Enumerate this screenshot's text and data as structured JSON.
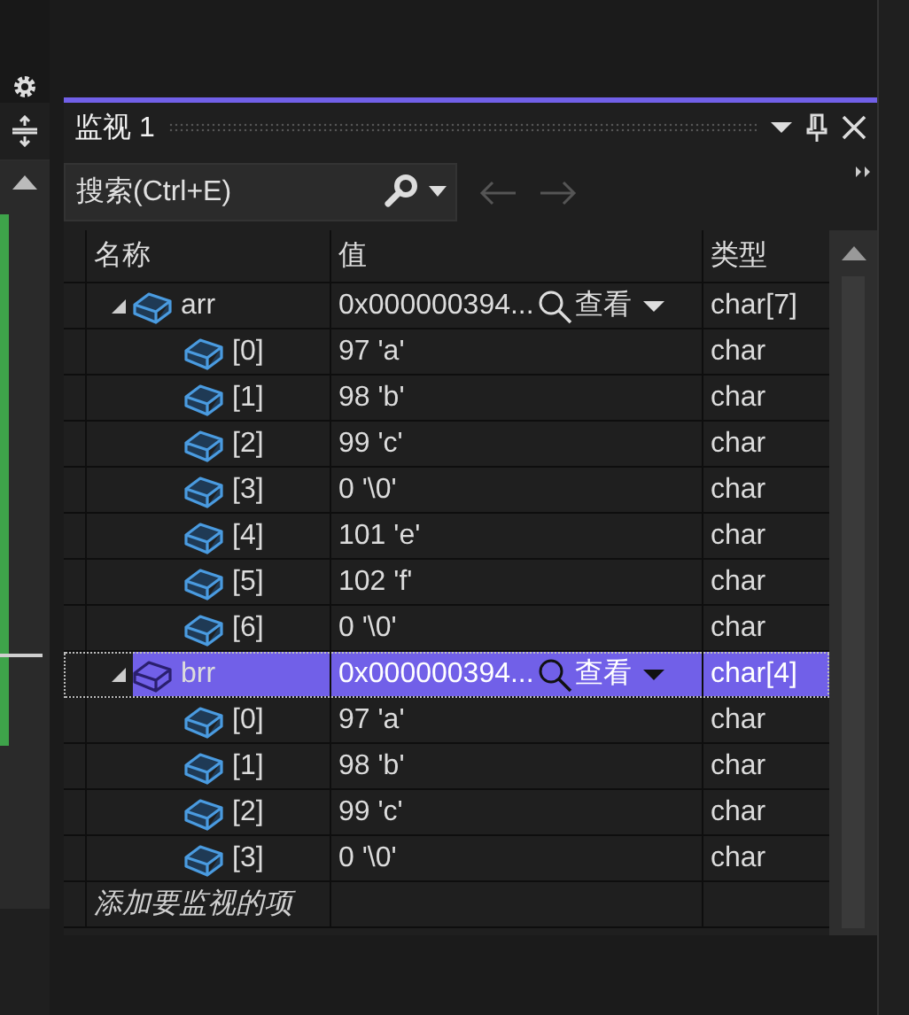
{
  "window": {
    "title": "监视 1"
  },
  "search": {
    "placeholder": "搜索(Ctrl+E)"
  },
  "columns": [
    "名称",
    "值",
    "类型"
  ],
  "rows": [
    {
      "name": "arr",
      "value": "0x000000394...",
      "view": "查看",
      "type": "char[7]",
      "expanded": true,
      "selected": false,
      "children": [
        {
          "name": "[0]",
          "value": "97 'a'",
          "type": "char",
          "selected": false
        },
        {
          "name": "[1]",
          "value": "98 'b'",
          "type": "char",
          "selected": false
        },
        {
          "name": "[2]",
          "value": "99 'c'",
          "type": "char",
          "selected": false
        },
        {
          "name": "[3]",
          "value": "0 '\\0'",
          "type": "char",
          "selected": false
        },
        {
          "name": "[4]",
          "value": "101 'e'",
          "type": "char",
          "selected": false
        },
        {
          "name": "[5]",
          "value": "102 'f'",
          "type": "char",
          "selected": false
        },
        {
          "name": "[6]",
          "value": "0 '\\0'",
          "type": "char",
          "selected": false
        }
      ]
    },
    {
      "name": "brr",
      "value": "0x000000394...",
      "view": "查看",
      "type": "char[4]",
      "expanded": true,
      "selected": true,
      "children": [
        {
          "name": "[0]",
          "value": "97 'a'",
          "type": "char",
          "selected": false
        },
        {
          "name": "[1]",
          "value": "98 'b'",
          "type": "char",
          "selected": false
        },
        {
          "name": "[2]",
          "value": "99 'c'",
          "type": "char",
          "selected": false
        },
        {
          "name": "[3]",
          "value": "0 '\\0'",
          "type": "char",
          "selected": false
        }
      ]
    }
  ],
  "add_item": {
    "placeholder": "添加要监视的项"
  }
}
